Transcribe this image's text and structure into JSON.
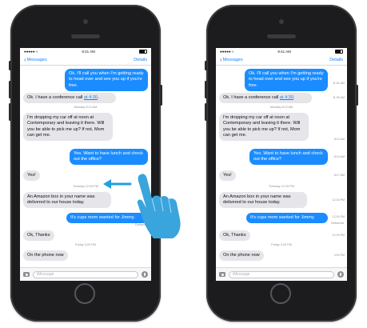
{
  "phones": [
    {
      "status": {
        "carrier": "●●●●● ≈",
        "time": "9:41 AM"
      },
      "nav": {
        "back_label": "Messages",
        "details_label": "Details"
      },
      "messages": [
        {
          "text": "Ok. I'll call you when I'm getting ready to head over and see you up if you're free."
        },
        {
          "text_prefix": "Ok. I have a conference call ",
          "link": "at 4:30",
          "text_suffix": "."
        },
        {
          "stamp": "Monday 8:12 AM"
        },
        {
          "text": "I'm dropping my car off at noon at Contemporary and leaving it there. Will you be able to pick me up? If not, Mom can get me."
        },
        {
          "text": "Yes. Want to have lunch and check out the office?"
        },
        {
          "text": "Yes!"
        },
        {
          "stamp": "Tuesday 12:15 PM"
        },
        {
          "text": "An Amazon box in your name was delivered to our house today."
        },
        {
          "text": "It's cups mom wanted for Jimmy."
        },
        {
          "delivered": "Delivered"
        },
        {
          "text": "Ok, Thanks"
        },
        {
          "stamp": "Friday 3:20 PM"
        },
        {
          "text": "On the phone now"
        }
      ],
      "input_placeholder": "iMessage"
    },
    {
      "status": {
        "carrier": "●●●●● ≈",
        "time": "9:41 AM"
      },
      "nav": {
        "back_label": "Messages",
        "details_label": "Details"
      },
      "messages": [
        {
          "text": "Ok. I'll call you when I'm getting ready to head over and see you up if you're free.",
          "time": "11:01 AM"
        },
        {
          "text_prefix": "Ok. I have a conference call ",
          "link": "at 4:30",
          "text_suffix": ".",
          "time": "11:05 AM"
        },
        {
          "stamp": "Monday 8:12 AM"
        },
        {
          "text": "I'm dropping my car off at noon at Contemporary and leaving it there. Will you be able to pick me up? If not, Mom can get me.",
          "time": "8:12 AM"
        },
        {
          "text": "Yes. Want to have lunch and check out the office?",
          "time": "8:14 AM"
        },
        {
          "text": "Yes!",
          "time": "8:17 AM"
        },
        {
          "stamp": "Tuesday 12:15 PM"
        },
        {
          "text": "An Amazon box in your name was delivered to our house today.",
          "time": "12:15 PM"
        },
        {
          "text": "It's cups mom wanted for Jimmy.",
          "time": "12:16 PM"
        },
        {
          "delivered": "Delivered"
        },
        {
          "text": "Ok, Thanks",
          "time": "12:20 PM"
        },
        {
          "stamp": "Friday 3:20 PM"
        },
        {
          "text": "On the phone now",
          "time": "3:20 PM"
        }
      ],
      "input_placeholder": "iMessage"
    }
  ],
  "colors": {
    "incoming_bubble": "#e5e5ea",
    "outgoing_bubble": "#1a8cff",
    "accent": "#1a82fb",
    "swipe_arrow": "#1fa0e0",
    "hand": "#3aa5dc"
  },
  "icons": [
    "camera-icon",
    "microphone-icon",
    "back-chevron-icon",
    "swipe-left-arrow-icon",
    "hand-gesture-icon"
  ]
}
